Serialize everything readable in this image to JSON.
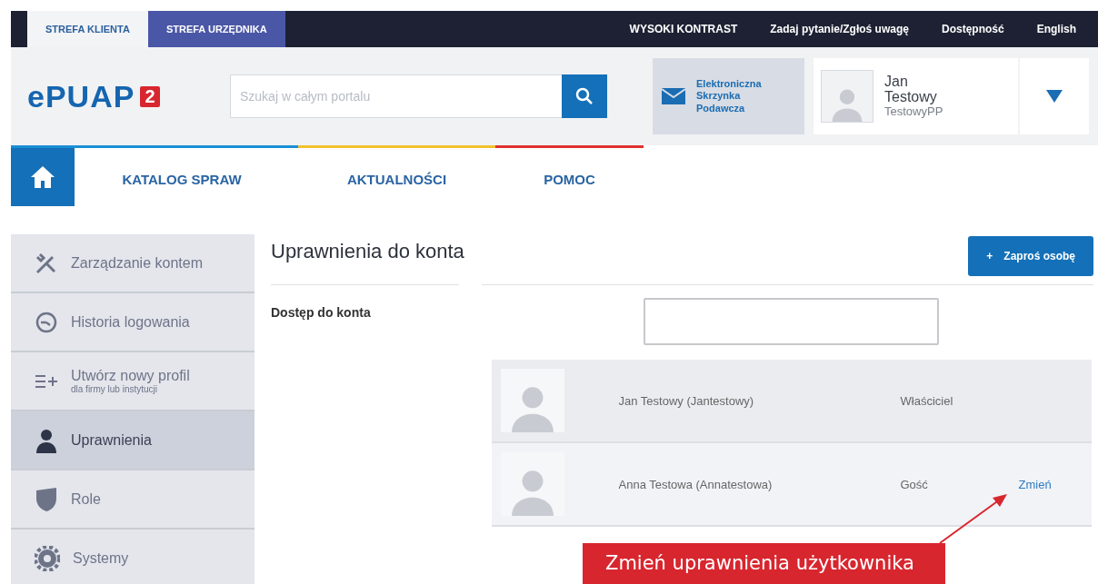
{
  "zone_tabs": [
    {
      "label": "STREFA KLIENTA",
      "selected": true
    },
    {
      "label": "STREFA URZĘDNIKA",
      "selected": false
    }
  ],
  "top_links": [
    "WYSOKI KONTRAST",
    "Zadaj pytanie/Zgłoś uwagę",
    "Dostępność",
    "English"
  ],
  "logo": {
    "text": "ePUAP",
    "badge": "2"
  },
  "search": {
    "placeholder": "Szukaj w całym portalu"
  },
  "mailbox": {
    "label": "Elektroniczna Skrzynka Podawcza"
  },
  "user": {
    "first_name": "Jan",
    "last_name": "Testowy",
    "profile": "TestowyPP"
  },
  "nav": [
    {
      "label": "KATALOG SPRAW",
      "color": "#1a8fd6"
    },
    {
      "label": "AKTUALNOŚCI",
      "color": "#f2c12e"
    },
    {
      "label": "POMOC",
      "color": "#e0312f"
    }
  ],
  "sidebar": {
    "items": [
      {
        "kind": "tools",
        "label": "Zarządzanie kontem",
        "selected": false
      },
      {
        "kind": "clock",
        "label": "Historia logowania",
        "selected": false
      },
      {
        "kind": "add",
        "label": "Utwórz nowy profil",
        "sublabel": "dla firmy lub instytucji",
        "selected": false
      },
      {
        "kind": "person",
        "label": "Uprawnienia",
        "selected": true
      },
      {
        "kind": "mask",
        "label": "Role",
        "selected": false
      },
      {
        "kind": "gear",
        "label": "Systemy",
        "selected": false
      }
    ]
  },
  "main": {
    "title": "Uprawnienia do konta",
    "invite_button": {
      "icon": "+",
      "label": "Zaproś osobę"
    },
    "section_label": "Dostęp do konta",
    "rows": [
      {
        "name": "Jan Testowy (Jantestowy)",
        "role": "Właściciel"
      },
      {
        "name": "Anna Testowa (Annatestowa)",
        "role": "Gość",
        "action": "Zmień"
      }
    ]
  },
  "callout": {
    "text": "Zmień uprawnienia użytkownika"
  }
}
